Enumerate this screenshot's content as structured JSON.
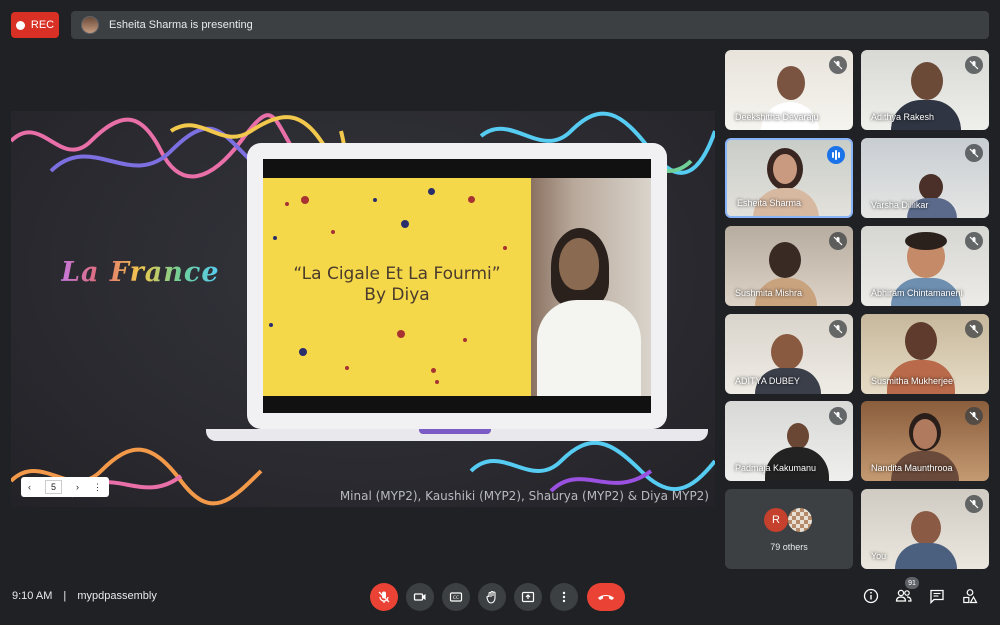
{
  "recording": {
    "label": "REC"
  },
  "presenting": {
    "text": "Esheita Sharma is presenting"
  },
  "slide": {
    "side_title": "La France",
    "title_line1": "“La Cigale Et La Fourmi”",
    "title_line2": "By Diya",
    "credits": "Minal (MYP2), Kaushiki (MYP2), Shaurya (MYP2) & Diya MYP2)",
    "page": "5"
  },
  "participants": [
    {
      "name": "Deekshitha Devaraju"
    },
    {
      "name": "Adithya Rakesh"
    },
    {
      "name": "Esheita Sharma"
    },
    {
      "name": "Varsha Dillikar"
    },
    {
      "name": "Sushmita Mishra"
    },
    {
      "name": "Abhiram Chintamaneni"
    },
    {
      "name": "ADITYA DUBEY"
    },
    {
      "name": "Susmitha Mukherjee"
    },
    {
      "name": "Padmaja Kakumanu"
    },
    {
      "name": "Nandita Maunthrooa"
    },
    {
      "name": "You"
    }
  ],
  "others": {
    "initial": "R",
    "label": "79 others"
  },
  "meeting": {
    "time": "9:10 AM",
    "separator": "|",
    "code": "mypdpassembly"
  },
  "people_count": "91",
  "colors": {
    "accent": "#1a73e8",
    "danger": "#ea4335",
    "slide_bg": "#f5d84a"
  }
}
